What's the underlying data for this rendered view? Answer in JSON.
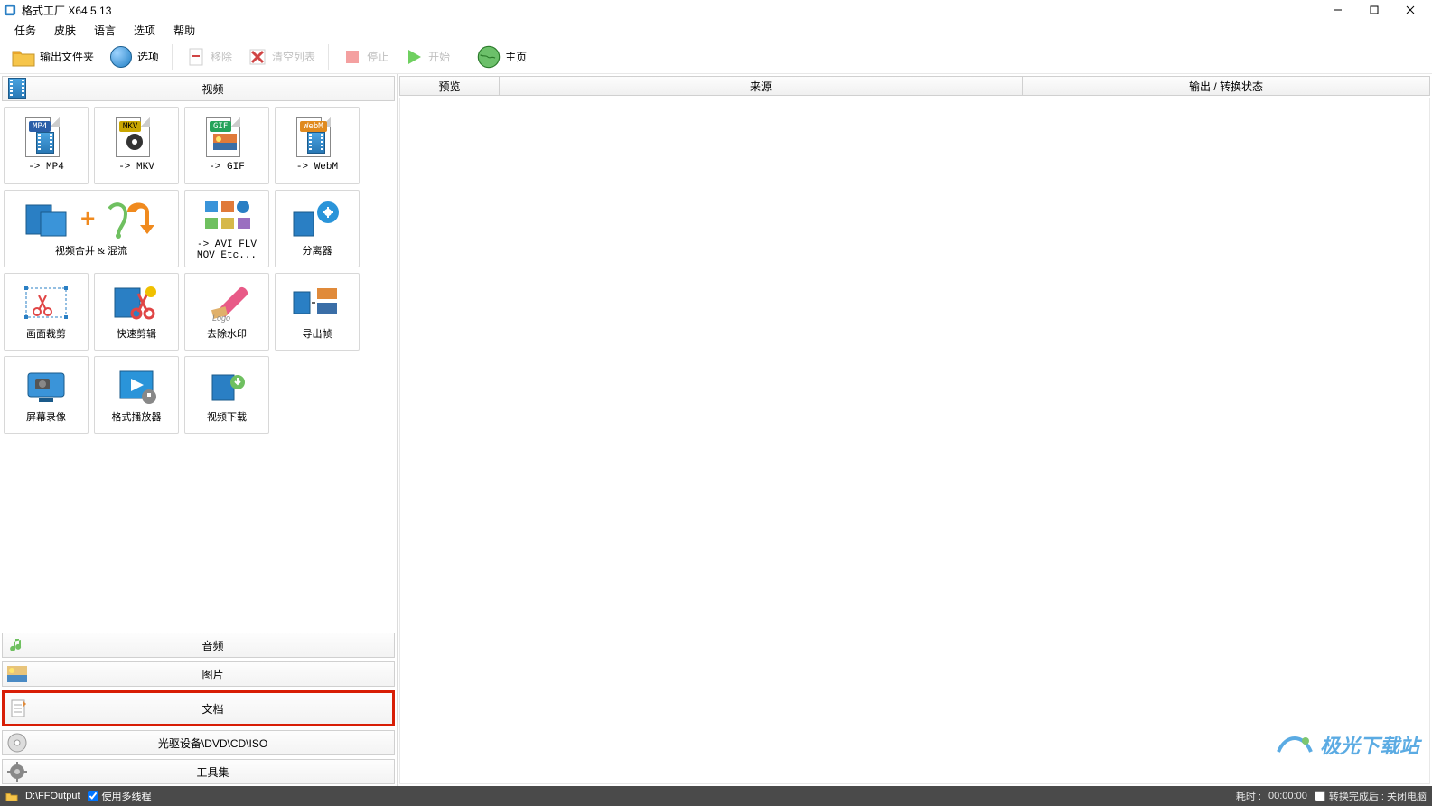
{
  "window": {
    "title": "格式工厂 X64 5.13"
  },
  "menu": {
    "task": "任务",
    "skin": "皮肤",
    "language": "语言",
    "option": "选项",
    "help": "帮助"
  },
  "toolbar": {
    "output_folder": "输出文件夹",
    "options": "选项",
    "remove": "移除",
    "clear_list": "清空列表",
    "stop": "停止",
    "start": "开始",
    "home": "主页"
  },
  "categories": {
    "video": "视频",
    "audio": "音频",
    "image": "图片",
    "document": "文档",
    "optical": "光驱设备\\DVD\\CD\\ISO",
    "tools": "工具集"
  },
  "tiles": {
    "mp4": "-> MP4",
    "mkv": "-> MKV",
    "gif": "-> GIF",
    "webm": "-> WebM",
    "merge": "视频合并 & 混流",
    "avi_etc": "-> AVI FLV\nMOV Etc...",
    "splitter": "分离器",
    "crop": "画面裁剪",
    "quick_clip": "快速剪辑",
    "remove_wm": "去除水印",
    "export_frame": "导出帧",
    "screen_rec": "屏幕录像",
    "ff_player": "格式播放器",
    "video_dl": "视频下载"
  },
  "table": {
    "preview": "预览",
    "source": "来源",
    "output": "输出 / 转换状态"
  },
  "status": {
    "output_path": "D:\\FFOutput",
    "multithread": "使用多线程",
    "elapsed_label": "耗时 :",
    "elapsed_value": "00:00:00",
    "after_complete": "转换完成后 : 关闭电脑",
    "watermark": "极光下载站"
  }
}
